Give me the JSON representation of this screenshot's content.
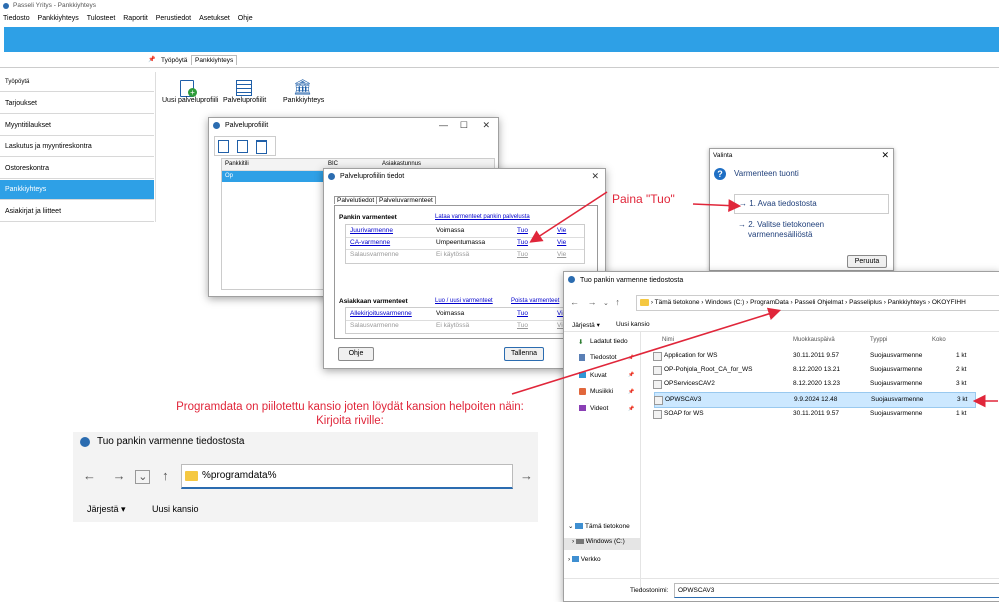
{
  "app": {
    "title": "Passeli Yritys - Pankkiyhteys",
    "menu": [
      "Tiedosto",
      "Pankkiyhteys",
      "Tulosteet",
      "Raportit",
      "Perustiedot",
      "Asetukset",
      "Ohje"
    ],
    "pin": "📌",
    "tabs": [
      "Työpöytä",
      "Pankkiyhteys"
    ]
  },
  "sidebar": {
    "items": [
      {
        "label": "Työpöytä",
        "active": false
      },
      {
        "label": "Tarjoukset",
        "active": false
      },
      {
        "label": "Myyntitilaukset",
        "active": false
      },
      {
        "label": "Laskutus ja myyntireskontra",
        "active": false
      },
      {
        "label": "Ostoreskontra",
        "active": false
      },
      {
        "label": "Pankkiyhteys",
        "active": true
      },
      {
        "label": "Asiakirjat ja liitteet",
        "active": false
      }
    ]
  },
  "toolbar": {
    "new_profile": "Uusi palveluprofiili",
    "profiles": "Palveluprofiilit",
    "bank_connection": "Pankkiyhteys"
  },
  "profiles_window": {
    "title": "Palveluprofiilit",
    "columns": [
      "Pankkitili",
      "BIC",
      "Asiakastunnus"
    ],
    "rows": [
      {
        "bank": "Op",
        "bic": "",
        "customer_id": ""
      }
    ]
  },
  "profile_details": {
    "title": "Palveluprofiilin tiedot",
    "tabs": [
      "Palvelutiedot",
      "Palveluvarmenteet"
    ],
    "bank_certs_header": "Pankin varmenteet",
    "bank_certs_link": "Lataa varmenteet pankin palvelusta",
    "bank_certs": [
      {
        "name": "Juurivarmenne",
        "status": "Voimassa",
        "import": "Tuo",
        "export": "Vie",
        "disabled": false
      },
      {
        "name": "CA-varmenne",
        "status": "Umpeentumassa",
        "import": "Tuo",
        "export": "Vie",
        "disabled": false
      },
      {
        "name": "Salausvarmenne",
        "status": "Ei käytössä",
        "import": "Tuo",
        "export": "Vie",
        "disabled": true
      }
    ],
    "customer_certs_header": "Asiakkaan varmenteet",
    "customer_certs_link_create": "Luo / uusi varmenteet",
    "customer_certs_link_delete": "Poista varmenteet",
    "customer_certs": [
      {
        "name": "Allekirjoitusvarmenne",
        "status": "Voimassa",
        "import": "Tuo",
        "export": "Vie",
        "disabled": false
      },
      {
        "name": "Salausvarmenne",
        "status": "Ei käytössä",
        "import": "Tuo",
        "export": "Vie",
        "disabled": true
      }
    ],
    "help_button": "Ohje",
    "save_button": "Tallenna"
  },
  "annotations": {
    "press_import": "Paina \"Tuo\"",
    "programdata_line1": "Programdata on piilotettu kansio joten löydät kansion helpoiten näin:",
    "programdata_line2": "Kirjoita riville:"
  },
  "choice_dialog": {
    "title": "Valinta",
    "heading": "Varmenteen tuonti",
    "option1": "→ 1. Avaa tiedostosta",
    "option2_line1": "→ 2. Valitse tietokoneen",
    "option2_line2": "varmennesäiliöstä",
    "cancel": "Peruuta"
  },
  "file_dialog": {
    "title": "Tuo pankin varmenne tiedostosta",
    "path": [
      "Tämä tietokone",
      "Windows (C:)",
      "ProgramData",
      "Passeli Ohjelmat",
      "Passeliplus",
      "Pankkiyhteys",
      "OKOYFIHH"
    ],
    "organize": "Järjestä ▾",
    "new_folder": "Uusi kansio",
    "columns": [
      "Nimi",
      "Muokkauspäivä",
      "Tyyppi",
      "Koko"
    ],
    "nav_items": [
      "Ladatut tiedo",
      "Tiedostot",
      "Kuvat",
      "Musiikki",
      "Videot"
    ],
    "nav_bottom": [
      "Tämä tietokone",
      "Windows (C:)",
      "Verkko"
    ],
    "files": [
      {
        "name": "Application for WS",
        "date": "30.11.2011 9.57",
        "type": "Suojausvarmenne",
        "size": "1 kt",
        "selected": false
      },
      {
        "name": "OP-Pohjola_Root_CA_for_WS",
        "date": "8.12.2020 13.21",
        "type": "Suojausvarmenne",
        "size": "2 kt",
        "selected": false
      },
      {
        "name": "OPServicesCAV2",
        "date": "8.12.2020 13.23",
        "type": "Suojausvarmenne",
        "size": "3 kt",
        "selected": false
      },
      {
        "name": "OPWSCAV3",
        "date": "9.9.2024 12.48",
        "type": "Suojausvarmenne",
        "size": "3 kt",
        "selected": true
      },
      {
        "name": "SOAP for WS",
        "date": "30.11.2011 9.57",
        "type": "Suojausvarmenne",
        "size": "1 kt",
        "selected": false
      }
    ],
    "filename_label": "Tiedostonimi:",
    "filename_value": "OPWSCAV3"
  },
  "zoom_panel": {
    "title": "Tuo pankin varmenne tiedostosta",
    "address_value": "%programdata%",
    "organize": "Järjestä ▾",
    "new_folder": "Uusi kansio"
  },
  "colors": {
    "accent_blue": "#2ea0e6",
    "annotation_red": "#e0263a",
    "selection": "#cce8ff"
  }
}
